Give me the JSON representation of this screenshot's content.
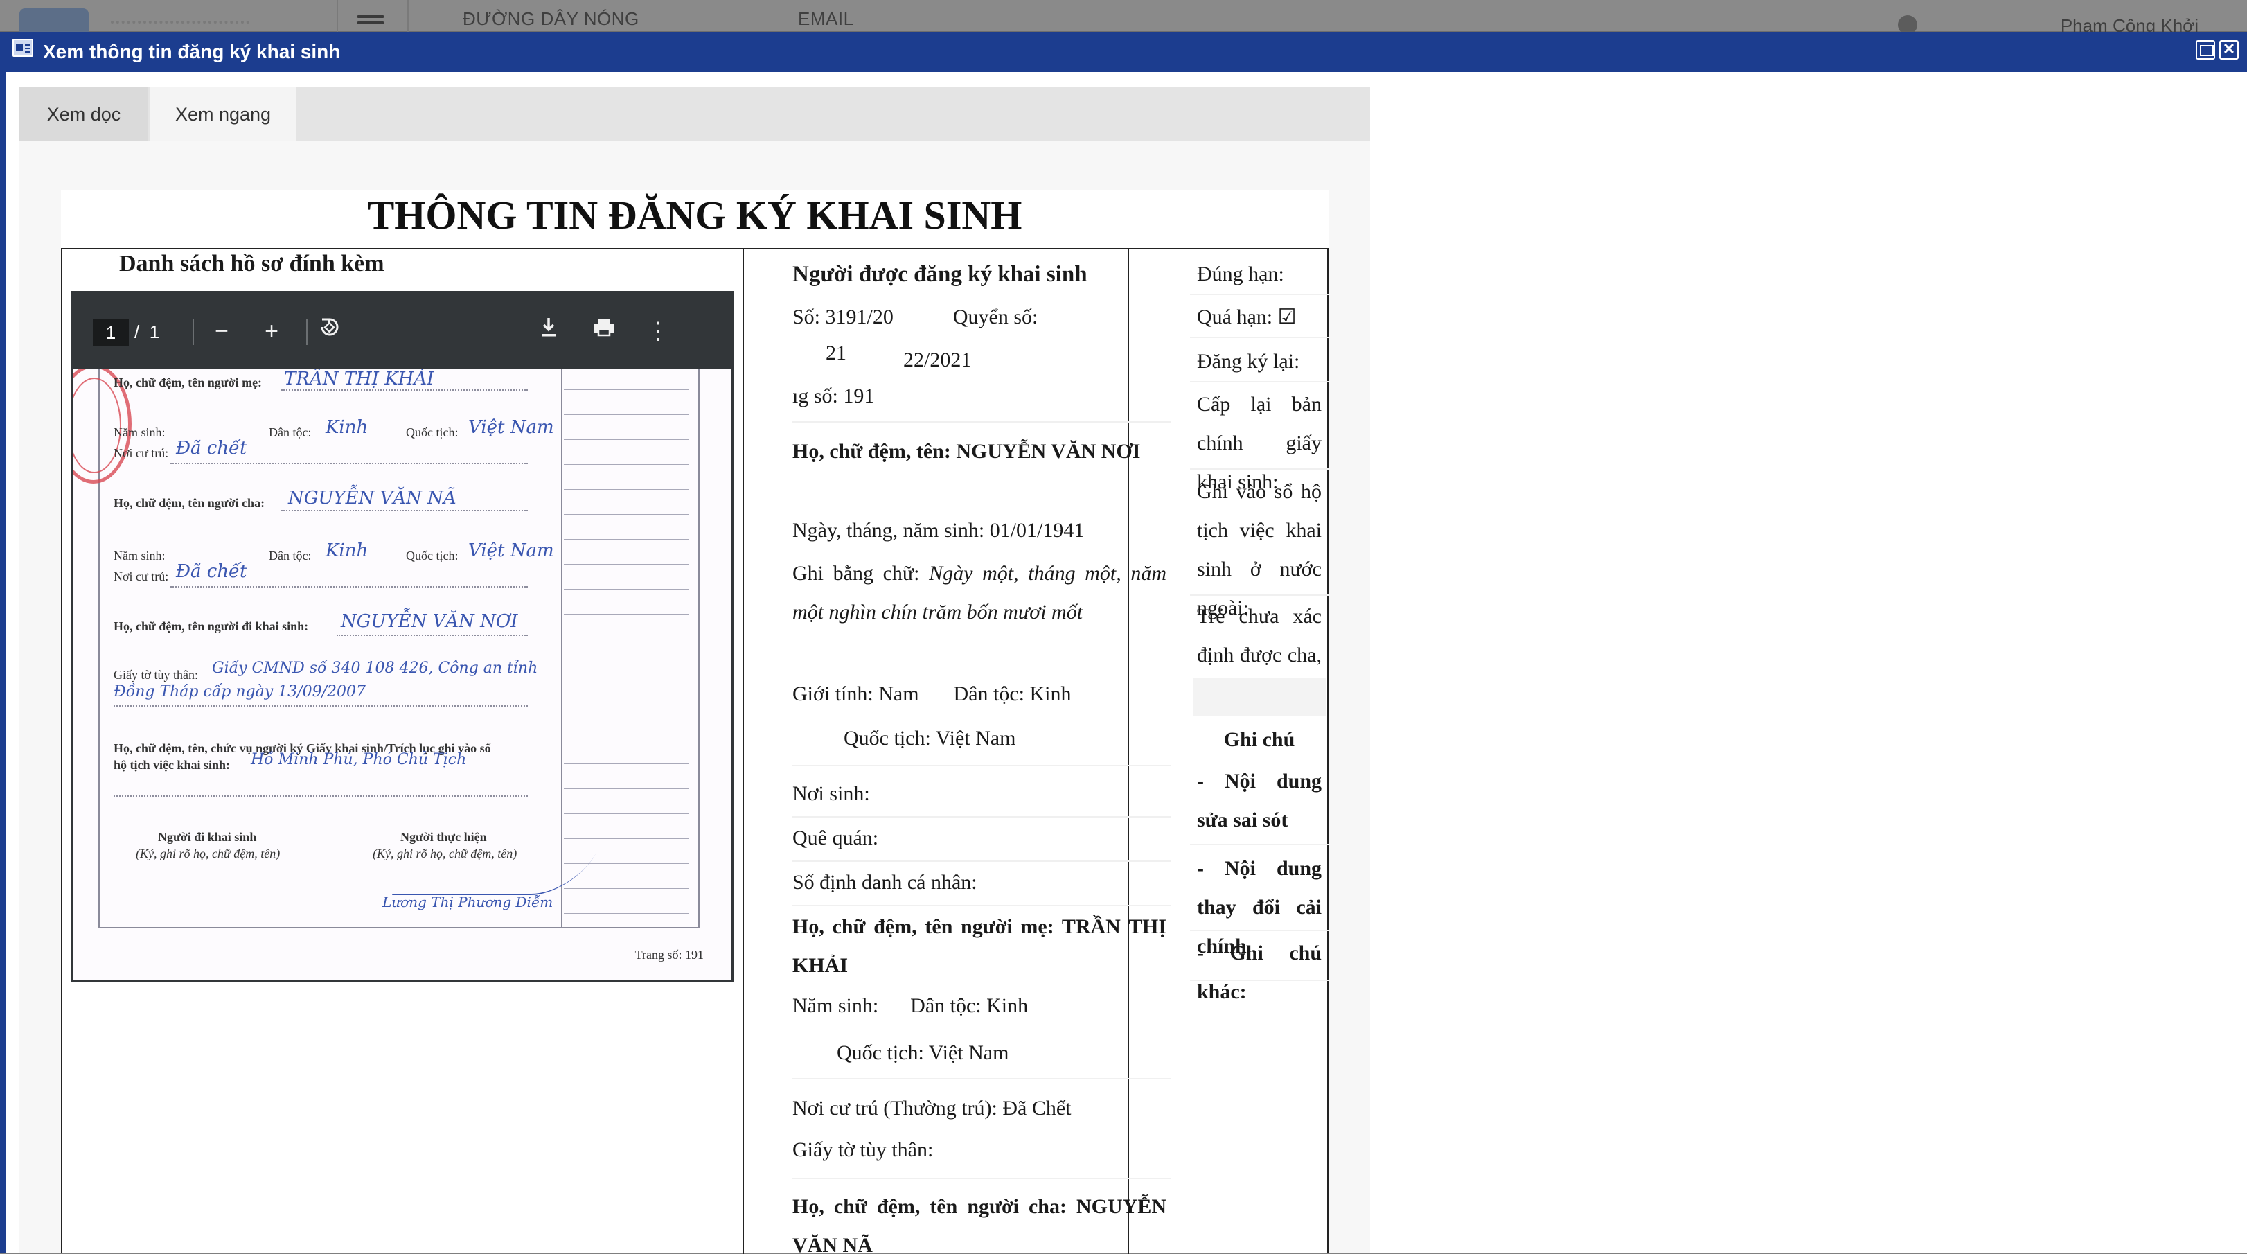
{
  "app_header": {
    "hotline": "ĐƯỜNG DÂY NÓNG",
    "email": "EMAIL",
    "user_name": "Phạm Công Khởi"
  },
  "modal": {
    "title": "Xem thông tin đăng ký khai sinh"
  },
  "tabs": [
    {
      "label": "Xem dọc",
      "active": false
    },
    {
      "label": "Xem ngang",
      "active": true
    }
  ],
  "page_title": "THÔNG TIN ĐĂNG KÝ KHAI SINH",
  "attachments": {
    "title": "Danh sách hồ sơ đính kèm",
    "viewer": {
      "current_page": "1",
      "page_separator": "/",
      "total_pages": "1"
    },
    "scan": {
      "mother_label": "Họ, chữ đệm, tên người mẹ:",
      "mother_value": "TRẦN THỊ KHẢI",
      "birth_year_label": "Năm sinh:",
      "ethnicity_label": "Dân tộc:",
      "ethnicity_value": "Kinh",
      "nationality_label": "Quốc tịch:",
      "nationality_value": "Việt Nam",
      "residence_label": "Nơi cư trú:",
      "residence_value": "Đã chết",
      "father_label": "Họ, chữ đệm, tên người cha:",
      "father_value": "NGUYỄN VĂN NÃ",
      "registrant_label": "Họ, chữ đệm, tên người đi khai sinh:",
      "registrant_value": "NGUYỄN VĂN NƠI",
      "id_label": "Giấy tờ tùy thân:",
      "id_value_1": "Giấy CMND số 340 108 426, Công an tỉnh",
      "id_value_2": "Đồng Tháp cấp ngày 13/09/2007",
      "signer_label_1": "Họ, chữ đệm, tên, chức vụ người ký Giấy khai sinh/Trích lục ghi vào sổ",
      "signer_label_2": "hộ tịch việc khai sinh:",
      "signer_value": "Hồ Minh Phú, Phó Chủ Tịch",
      "col1_title": "Người đi khai sinh",
      "col1_note": "(Ký, ghi rõ họ, chữ đệm, tên)",
      "col2_title": "Người thực hiện",
      "col2_note": "(Ký, ghi rõ họ, chữ đệm, tên)",
      "executor_name": "Lương Thị Phương Diễm",
      "page_no": "Trang số: 191"
    }
  },
  "registration": {
    "section_title": "Người được đăng ký khai sinh",
    "so_label": "Số:",
    "so_value": "3191/20",
    "so_wrap": "21",
    "quyen_so_label": "Quyển số:",
    "quyen_so_value": "22/2021",
    "trang_so_clipped": "ıg số: 191",
    "full_name_label": "Họ, chữ đệm, tên:",
    "full_name_value": "NGUYỄN VĂN NƠI",
    "dob_label": "Ngày, tháng, năm sinh:",
    "dob_value": "01/01/1941",
    "dob_words_label": "Ghi bằng chữ:",
    "dob_words_value": "Ngày một, tháng một, năm một nghìn chín trăm bốn mươi mốt",
    "gender_label": "Giới tính:",
    "gender_value": "Nam",
    "ethnicity_label": "Dân tộc:",
    "ethnicity_value": "Kinh",
    "nationality_label": "Quốc tịch:",
    "nationality_value": "Việt Nam",
    "birthplace_label": "Nơi sinh:",
    "hometown_label": "Quê quán:",
    "personal_id_label": "Số định danh cá nhân:",
    "mother_label": "Họ, chữ đệm, tên người mẹ:",
    "mother_value": "TRẦN THỊ KHẢI",
    "mother_birth_year_label": "Năm sinh:",
    "mother_ethnicity": "Dân tộc: Kinh",
    "mother_nationality": "Quốc tịch: Việt Nam",
    "mother_residence": "Nơi cư trú (Thường trú): Đã Chết",
    "mother_id": "Giấy tờ tùy thân:",
    "father_label": "Họ, chữ đệm, tên người cha:",
    "father_value_clipped": "NGUYỄN VĂN NÃ"
  },
  "status": {
    "on_time": "Đúng hạn:",
    "overdue": "Quá hạn: ☑",
    "re_register": "Đăng ký lại:",
    "reissue": "Cấp lại bản chính giấy khai sinh:",
    "foreign_record": "Ghi vào sổ hộ tịch việc khai sinh ở nước ngoài:",
    "unknown_parents": "Trẻ chưa xác định được cha, mẹ:",
    "notes_title": "Ghi chú",
    "note_fix": "- Nội dung sửa sai sót",
    "note_change": "- Nội dung thay đổi cải chính",
    "note_other": "- Ghi chú khác:"
  }
}
